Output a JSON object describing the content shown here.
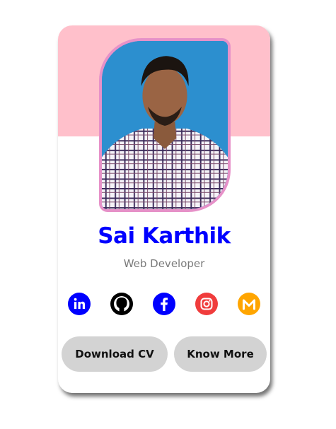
{
  "profile": {
    "name": "Sai Karthik",
    "role": "Web Developer",
    "photo_alt": "Profile photo"
  },
  "socials": [
    {
      "id": "linkedin",
      "icon": "linkedin-icon",
      "color": "#0000ff"
    },
    {
      "id": "github",
      "icon": "github-icon",
      "color": "#000000"
    },
    {
      "id": "facebook",
      "icon": "facebook-icon",
      "color": "#0000ff"
    },
    {
      "id": "instagram",
      "icon": "instagram-icon",
      "color": "#f03c3c"
    },
    {
      "id": "medium",
      "icon": "medium-icon",
      "color": "#ffa500"
    }
  ],
  "buttons": {
    "download_cv": "Download CV",
    "know_more": "Know More"
  },
  "colors": {
    "accent_blue": "#0000ff",
    "header_pink": "#ffc0cb",
    "photo_border": "#e691c8",
    "button_bg": "#d3d3d3",
    "role_gray": "#7a7a7a"
  }
}
